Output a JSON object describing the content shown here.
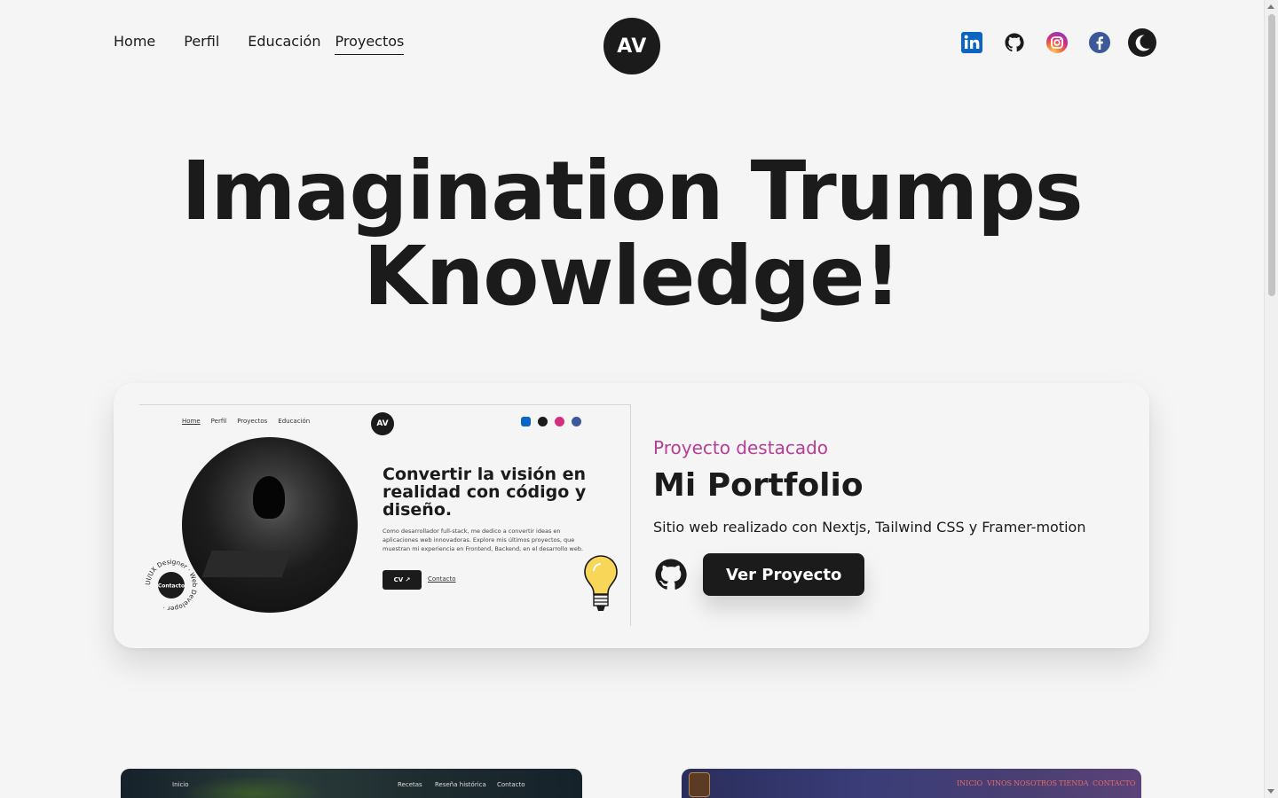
{
  "nav": {
    "items": [
      {
        "label": "Home",
        "active": false
      },
      {
        "label": "Perfil",
        "active": false
      },
      {
        "label": "Educación",
        "active": false
      },
      {
        "label": "Proyectos",
        "active": true
      }
    ]
  },
  "logo": {
    "text": "AV"
  },
  "social": [
    "linkedin-icon",
    "github-icon",
    "instagram-icon",
    "facebook-icon",
    "dark-mode-toggle-icon"
  ],
  "colors": {
    "background": "#f5f5f5",
    "text": "#1b1b1b",
    "accent": "#b63e96",
    "linkedin": "#0a66c2",
    "facebook": "#3b5998"
  },
  "hero": {
    "line1": "Imagination Trumps",
    "line2": "Knowledge!"
  },
  "featured": {
    "eyebrow": "Proyecto destacado",
    "title": "Mi Portfolio",
    "description": "Sitio web realizado con Nextjs, Tailwind CSS y Framer-motion",
    "button": "Ver Proyecto",
    "preview": {
      "nav": [
        "Home",
        "Perfil",
        "Proyectos",
        "Educación"
      ],
      "logo": "AV",
      "heading": "Convertir la visión en realidad con código y diseño.",
      "paragraph": "Como desarrollador full-stack, me dedico a convertir ideas en aplicaciones web innovadoras. Explore mis últimos proyectos, que muestran mi experiencia en Frontend, Backend, en el desarrollo web.",
      "cv_label": "CV",
      "contact_link": "Contacto",
      "ring_text": "UI/UX Designer · Web Developer ·",
      "ring_center": "Contacto"
    }
  },
  "bottom_cards": [
    {
      "nav": [
        "Inicio",
        "Recetas",
        "Reseña histórica",
        "Contacto"
      ]
    },
    {
      "nav": [
        "INICIO",
        "VINOS",
        "NOSOTROS",
        "TIENDA",
        "CONTACTO"
      ]
    }
  ]
}
